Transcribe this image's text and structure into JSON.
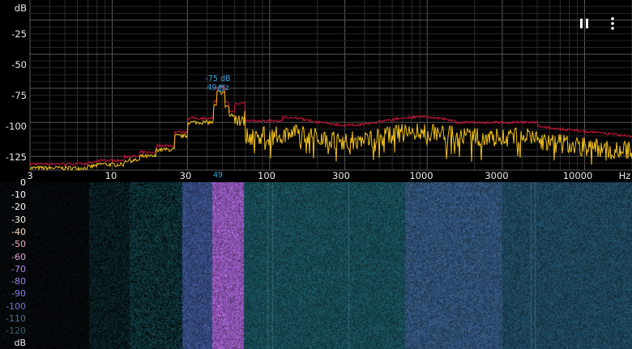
{
  "spectrum": {
    "y_unit": "dB",
    "y_ticks": [
      "-25",
      "-50",
      "-75",
      "-100",
      "-125"
    ],
    "x_unit": "Hz",
    "x_ticks": [
      "3",
      "10",
      "30",
      "100",
      "300",
      "1000",
      "3000",
      "10000"
    ],
    "peak": {
      "db_label": "-75 dB",
      "hz_label": "49 Hz",
      "axis_label": "49"
    },
    "colors": {
      "realtime": "#f2c21a",
      "max_hold": "#c8143c",
      "grid": "#3a3a3a",
      "marker": "#3ba3e0"
    }
  },
  "controls": {
    "pause_icon": "pause-icon",
    "menu_icon": "more-vert-icon"
  },
  "spectrogram": {
    "scale_labels": [
      "0",
      "-10",
      "-20",
      "-30",
      "-40",
      "-50",
      "-60",
      "-70",
      "-80",
      "-90",
      "-100",
      "-110",
      "-120"
    ],
    "scale_colors": [
      "#ffffff",
      "#ffffff",
      "#ffffff",
      "#fff4e8",
      "#ffd8c0",
      "#f3b0c0",
      "#e3a0d8",
      "#b98ce6",
      "#9a86e6",
      "#7f82e0",
      "#6e78cc",
      "#52708e",
      "#3f5f6e"
    ],
    "unit": "dB"
  }
}
